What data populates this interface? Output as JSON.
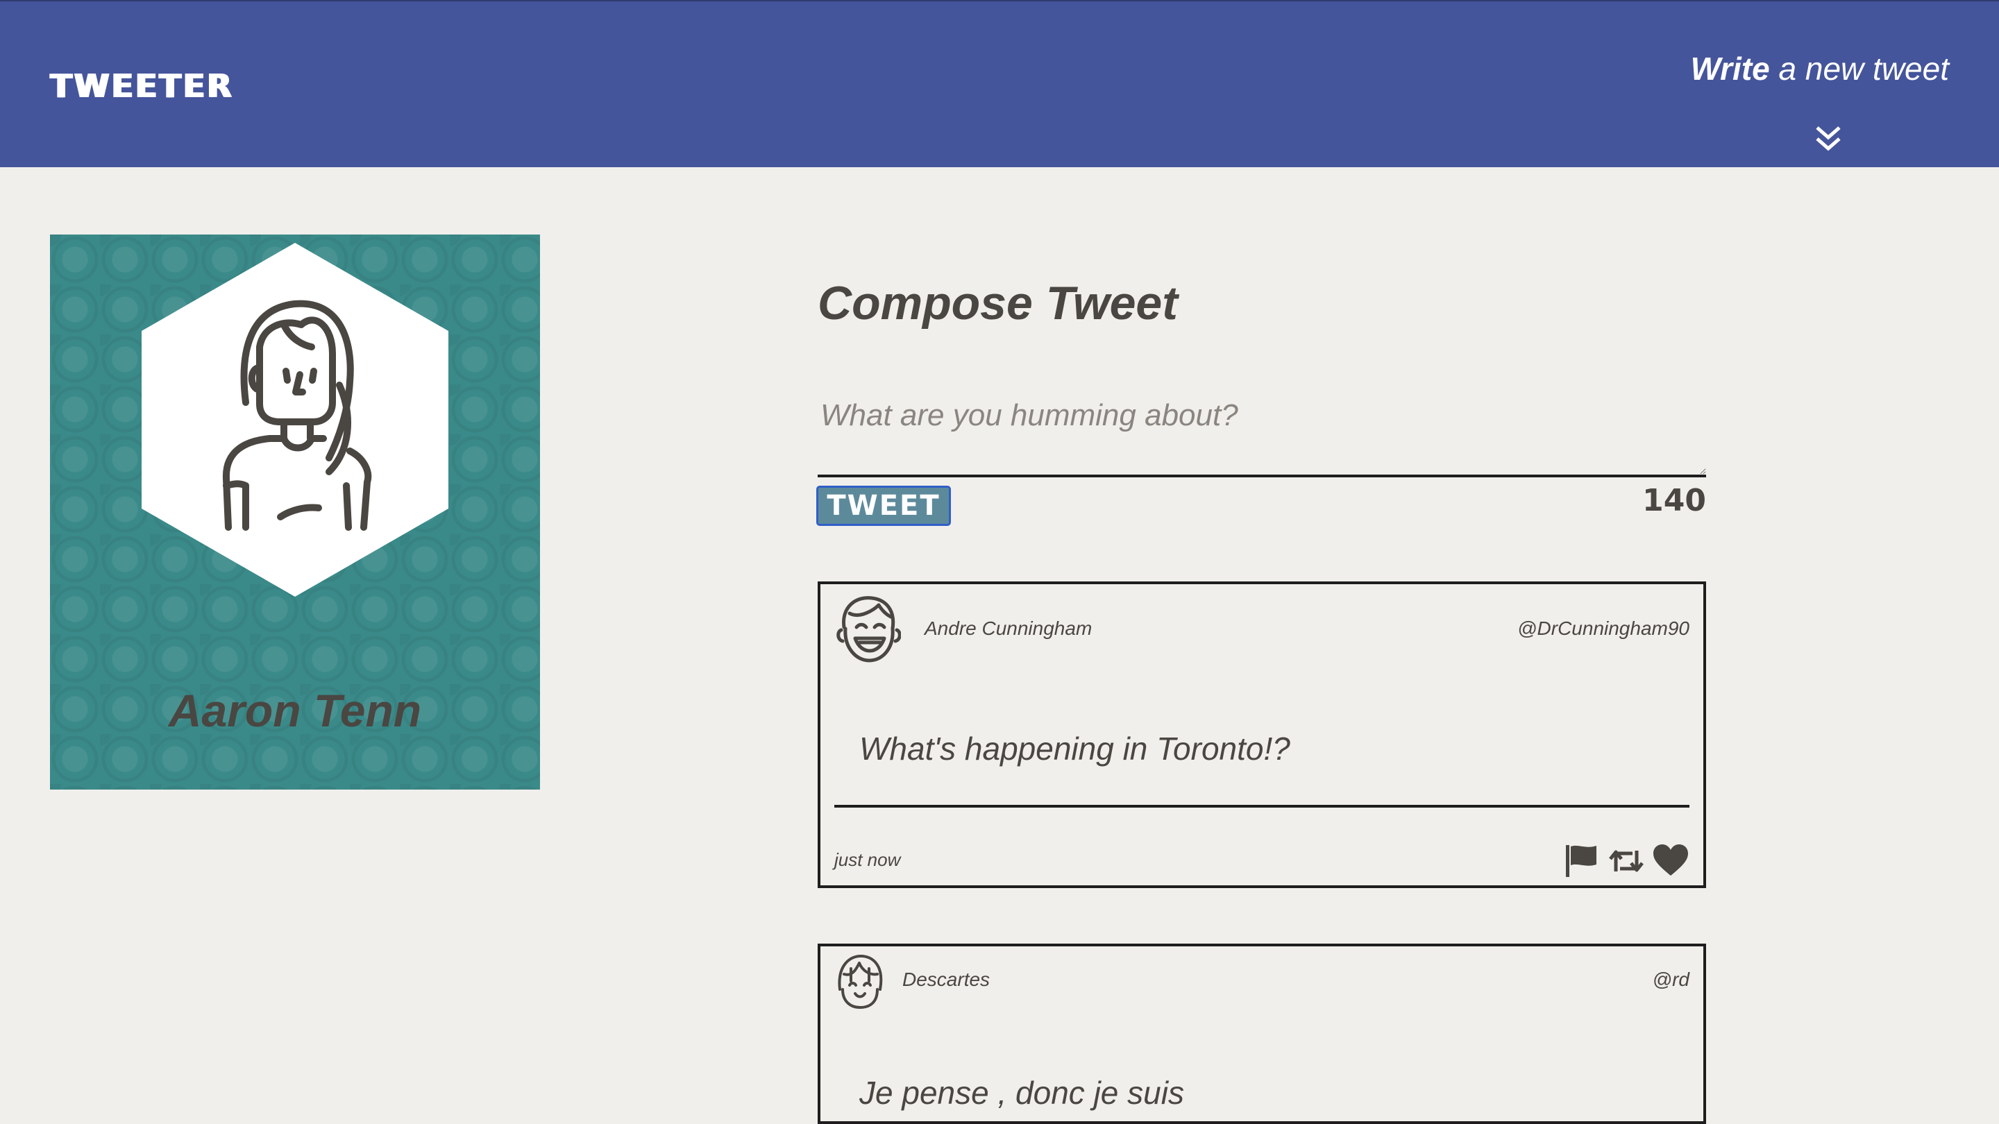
{
  "nav": {
    "brand": "TWEETER",
    "compose_toggle_bold": "Write",
    "compose_toggle_rest": "a new tweet",
    "chevron_icon": "double-chevron-down-icon"
  },
  "profile": {
    "name": "Aaron Tenn",
    "avatar_icon": "woman-avatar-icon",
    "background_color": "#3b8a8a"
  },
  "compose": {
    "title": "Compose Tweet",
    "placeholder": "What are you humming about?",
    "button_label": "TWEET",
    "counter": "140"
  },
  "tweets": [
    {
      "name": "Andre Cunningham",
      "handle": "@DrCunningham90",
      "text": "What's happening in Toronto!?",
      "time": "just now",
      "avatar_icon": "laughing-man-avatar-icon",
      "actions": [
        "flag-icon",
        "retweet-icon",
        "heart-icon"
      ]
    },
    {
      "name": "Descartes",
      "handle": "@rd",
      "text": "Je pense , donc je suis",
      "avatar_icon": "smiling-girl-avatar-icon"
    }
  ],
  "colors": {
    "nav": "#45559b",
    "page": "#f1efeb",
    "text": "#4a4641",
    "button": "#5d8a9b"
  }
}
